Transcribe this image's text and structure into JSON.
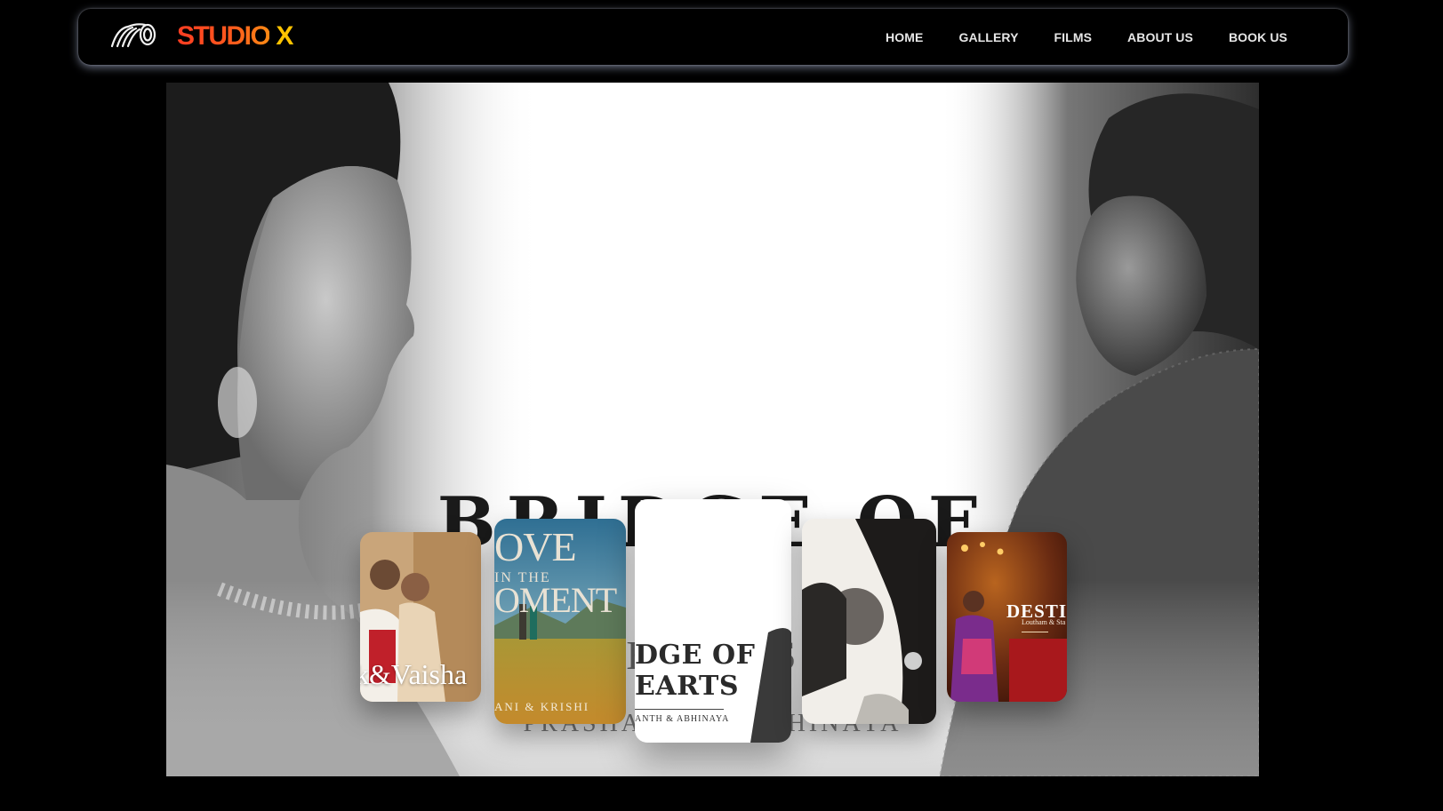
{
  "brand": {
    "name_part1": "STUDIO",
    "name_part2": "X",
    "logo_icon": "camera-lens-icon",
    "colors": {
      "studio": "#ff4d1c",
      "x": "#ffc400"
    }
  },
  "nav": {
    "items": [
      {
        "label": "HOME"
      },
      {
        "label": "GALLERY"
      },
      {
        "label": "FILMS"
      },
      {
        "label": "ABOUT US"
      },
      {
        "label": "BOOK US"
      }
    ]
  },
  "hero": {
    "headline": "BRIDGE OF",
    "headline_line2": "HEARTS",
    "sub": "PRASHANTH & ABHINAYA"
  },
  "carousel": {
    "cards": [
      {
        "title": "k&Vaisha"
      },
      {
        "title_line1": "OVE",
        "title_line2": "IN THE",
        "title_line3": "OMENT",
        "names": "ANI & KRISHI"
      },
      {
        "title_line1": "DGE OF",
        "title_line2": "EARTS",
        "names": "ANTH & ABHINAYA"
      },
      {},
      {
        "title": "DESTIN",
        "names": "Loutham & Sta"
      }
    ]
  },
  "colors": {
    "background": "#000000",
    "hero_bg": "#ffffff",
    "nav_text": "#e6e6e6"
  }
}
